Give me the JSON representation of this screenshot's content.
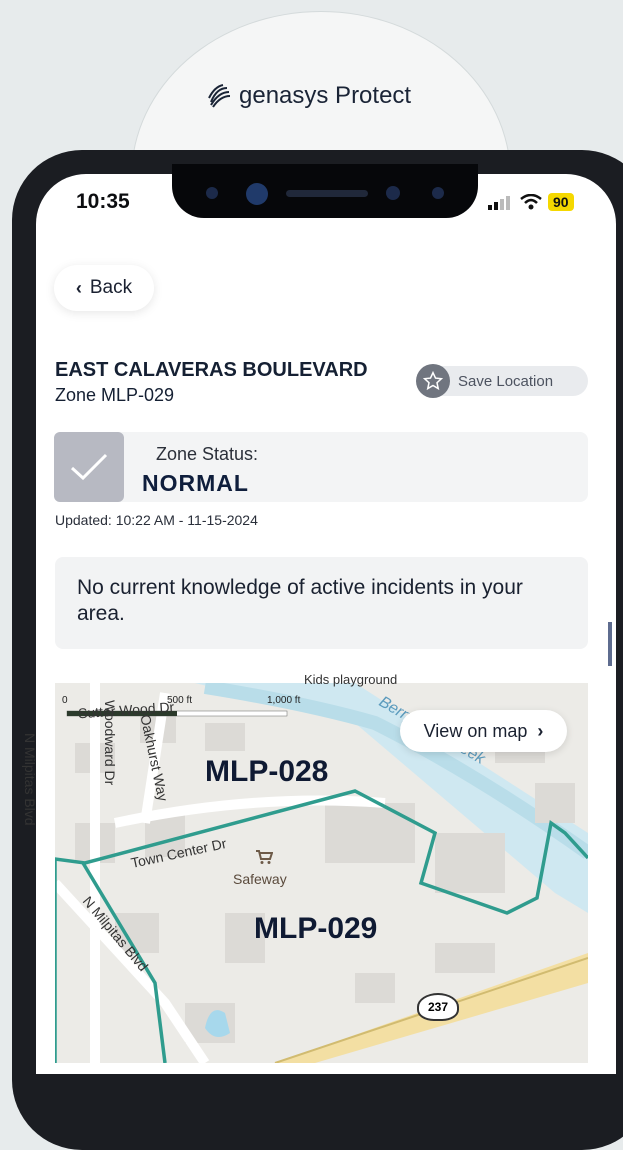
{
  "brand": {
    "name": "genasys Protect"
  },
  "status_bar": {
    "time": "10:35",
    "battery": "90"
  },
  "nav": {
    "back_label": "Back"
  },
  "location": {
    "title": "EAST CALAVERAS BOULEVARD",
    "zone": "Zone MLP-029",
    "save_label": "Save Location"
  },
  "zone_status": {
    "label": "Zone Status:",
    "value": "NORMAL",
    "updated": "Updated: 10:22 AM - 11-15-2024"
  },
  "incident": {
    "message": "No current knowledge of active incidents in your area."
  },
  "map": {
    "view_label": "View on map",
    "zones": [
      "MLP-028",
      "MLP-029"
    ],
    "streets": {
      "sutter": "Sutter Wood Dr",
      "woodward": "Woodward Dr",
      "oakhurst": "Oakhurst Way",
      "town_center": "Town Center Dr",
      "n_milpitas_left": "N Milpitas Blvd",
      "n_milpitas_diag": "N Milpitas Blvd",
      "berryessa": "Berryessa Creek",
      "kids": "Kids playground"
    },
    "scale": {
      "zero": "0",
      "mid": "500 ft",
      "end": "1,000 ft"
    },
    "poi": "Safeway",
    "highway": "237"
  },
  "colors": {
    "zone_border": "#2f9c8e",
    "battery": "#f5d800"
  }
}
